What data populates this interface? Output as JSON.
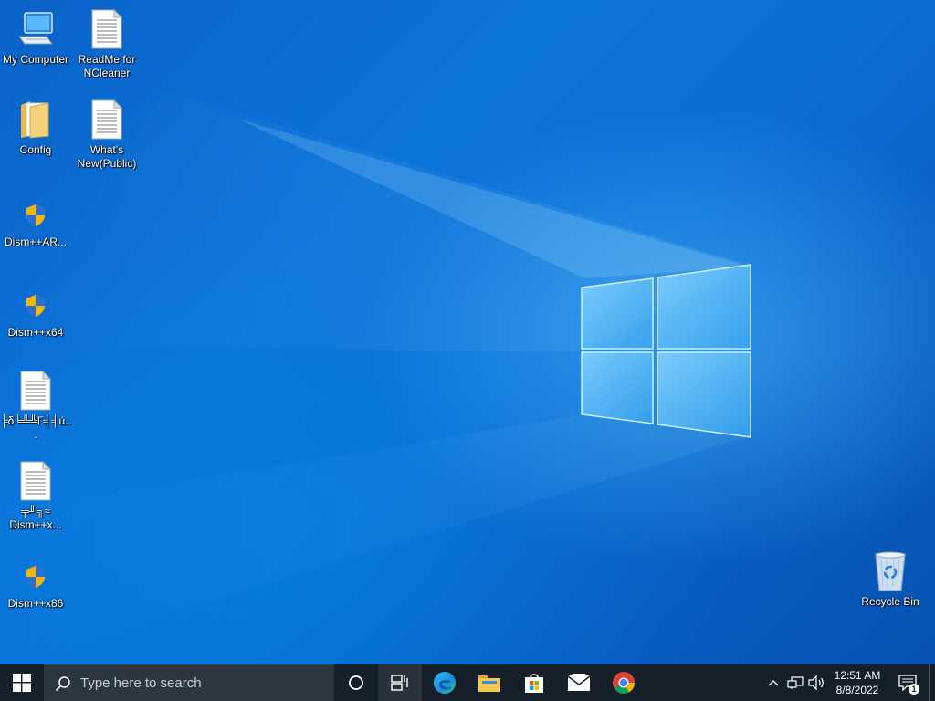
{
  "desktop": {
    "icons": [
      {
        "label": "My Computer",
        "icon": "computer-icon"
      },
      {
        "label": "ReadMe for\nNCleaner",
        "icon": "text-document-icon"
      },
      {
        "label": "Config",
        "icon": "folder-icon"
      },
      {
        "label": "What's\nNew(Public)",
        "icon": "text-document-icon"
      },
      {
        "label": "Dism++AR...",
        "icon": "uac-shield-icon"
      },
      {
        "label": "Dism++x64",
        "icon": "uac-shield-icon"
      },
      {
        "label": "╞δ╘╩╩Γ╡╡ú...",
        "icon": "text-document-icon"
      },
      {
        "label": "╤╜╗≈\nDism++x...",
        "icon": "text-document-icon"
      },
      {
        "label": "Dism++x86",
        "icon": "uac-shield-icon"
      },
      {
        "label": "Recycle Bin",
        "icon": "recycle-bin-icon"
      }
    ]
  },
  "taskbar": {
    "search_placeholder": "Type here to search",
    "pinned_apps": [
      "edge-icon",
      "file-explorer-icon",
      "microsoft-store-icon",
      "mail-icon",
      "chrome-icon"
    ],
    "tray": {
      "time": "12:51 AM",
      "date": "8/8/2022",
      "notification_count": "1"
    }
  },
  "colors": {
    "taskbar": "#15202b",
    "search_box": "#2c3640",
    "wallpaper_accent": "#0b74da"
  }
}
